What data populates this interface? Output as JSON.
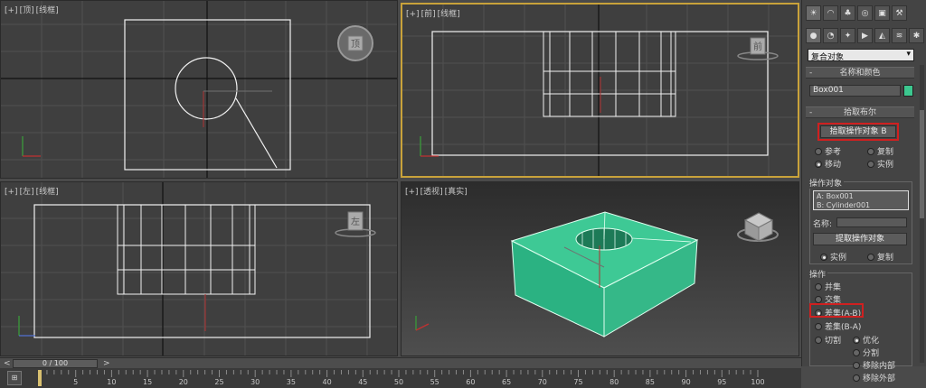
{
  "viewports": {
    "top": {
      "label": [
        "[+]",
        "[顶]",
        "[线框]"
      ],
      "cube_face": "顶"
    },
    "front": {
      "label": [
        "[+]",
        "[前]",
        "[线框]"
      ],
      "cube_face": "前"
    },
    "left": {
      "label": [
        "[+]",
        "[左]",
        "[线框]"
      ],
      "cube_face": "左"
    },
    "persp": {
      "label": [
        "[+]",
        "[透视]",
        "[真实]"
      ]
    }
  },
  "panel": {
    "tabs": [
      "create-icon",
      "modify-icon",
      "hierarchy-icon",
      "motion-icon",
      "display-icon",
      "utilities-icon"
    ],
    "subtabs": [
      "geometry-icon",
      "shapes-icon",
      "lights-icon",
      "cameras-icon",
      "helpers-icon",
      "spacewarps-icon",
      "systems-icon"
    ],
    "category": "复合对象",
    "name_color": {
      "title": "名称和颜色",
      "name": "Box001",
      "color": "#3cc78f"
    },
    "pick_boolean": {
      "title": "拾取布尔",
      "pick_button": "拾取操作对象 B",
      "options": [
        "参考",
        "复制",
        "移动",
        "实例"
      ],
      "selected": "移动"
    },
    "operands": {
      "title": "操作对象",
      "items": [
        "A: Box001",
        "B: Cylinder001"
      ],
      "name_label": "名称:",
      "extract_button": "提取操作对象",
      "modes": [
        "实例",
        "复制"
      ],
      "selected_mode": "实例"
    },
    "operation": {
      "title": "操作",
      "items": [
        "并集",
        "交集",
        "差集(A-B)",
        "差集(B-A)",
        "切割"
      ],
      "selected": "差集(A-B)",
      "cut_options": [
        "优化",
        "分割",
        "移除内部",
        "移除外部"
      ],
      "selected_cut": "优化"
    }
  },
  "timeline": {
    "frame_display": "0 / 100",
    "prev_arrow": "<",
    "next_arrow": ">",
    "ticks": [
      "5",
      "10",
      "15",
      "20",
      "25",
      "30",
      "35",
      "40",
      "45",
      "50",
      "55",
      "60",
      "65",
      "70",
      "75",
      "80",
      "85",
      "90",
      "95",
      "100"
    ],
    "current_frame": 0
  }
}
